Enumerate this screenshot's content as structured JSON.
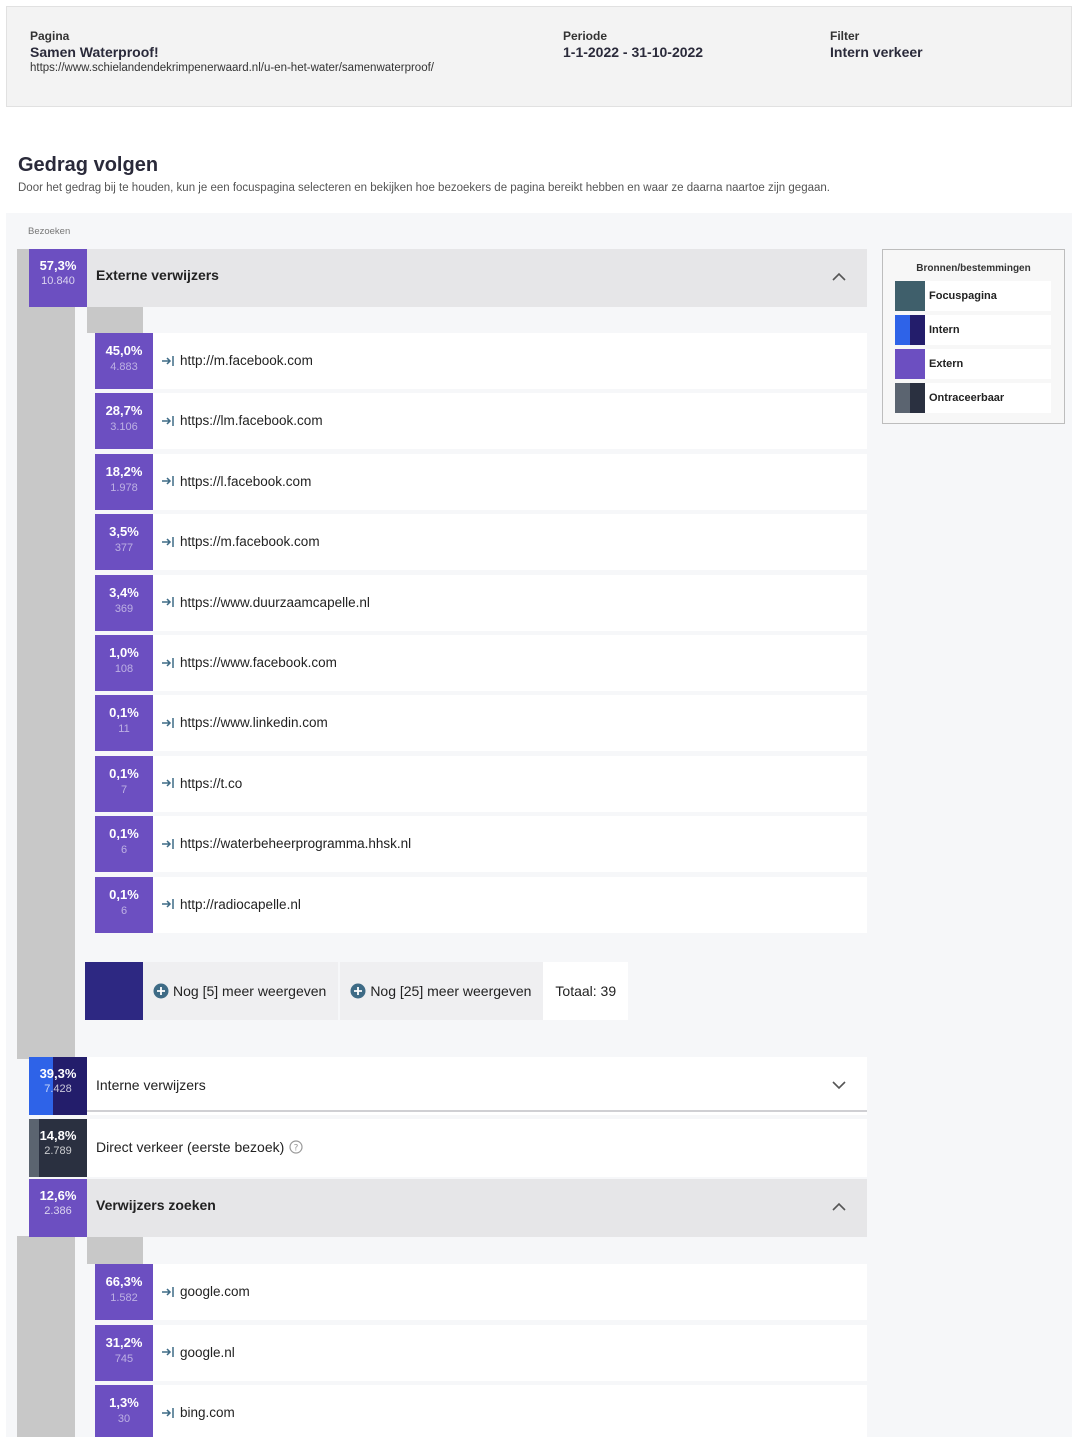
{
  "header": {
    "pagina_label": "Pagina",
    "pagina_title": "Samen Waterproof!",
    "pagina_url": "https://www.schielandendekrimpenerwaard.nl/u-en-het-water/samenwaterproof/",
    "periode_label": "Periode",
    "periode_value": "1-1-2022 - 31-10-2022",
    "filter_label": "Filter",
    "filter_value": "Intern verkeer"
  },
  "section": {
    "title": "Gedrag volgen",
    "description": "Door het gedrag bij te houden, kun je een focuspagina selecteren en bekijken hoe bezoekers de pagina bereikt hebben en waar ze daarna naartoe zijn gegaan.",
    "bezoeken_label": "Bezoeken"
  },
  "groups": [
    {
      "title": "Externe verwijzers",
      "pct": "57,3%",
      "count": "10.840",
      "state": "expanded",
      "children": [
        {
          "pct": "45,0%",
          "count": "4.883",
          "url": "http://m.facebook.com"
        },
        {
          "pct": "28,7%",
          "count": "3.106",
          "url": "https://lm.facebook.com"
        },
        {
          "pct": "18,2%",
          "count": "1.978",
          "url": "https://l.facebook.com"
        },
        {
          "pct": "3,5%",
          "count": "377",
          "url": "https://m.facebook.com"
        },
        {
          "pct": "3,4%",
          "count": "369",
          "url": "https://www.duurzaamcapelle.nl"
        },
        {
          "pct": "1,0%",
          "count": "108",
          "url": "https://www.facebook.com"
        },
        {
          "pct": "0,1%",
          "count": "11",
          "url": "https://www.linkedin.com"
        },
        {
          "pct": "0,1%",
          "count": "7",
          "url": "https://t.co"
        },
        {
          "pct": "0,1%",
          "count": "6",
          "url": "https://waterbeheerprogramma.hhsk.nl"
        },
        {
          "pct": "0,1%",
          "count": "6",
          "url": "http://radiocapelle.nl"
        }
      ],
      "more": {
        "more5": "Nog [5] meer weergeven",
        "more25": "Nog [25] meer weergeven",
        "total": "Totaal: 39"
      }
    },
    {
      "title": "Interne verwijzers",
      "pct": "39,3%",
      "count": "7.428",
      "state": "collapsed"
    },
    {
      "title": "Direct verkeer (eerste bezoek)",
      "pct": "14,8%",
      "count": "2.789",
      "state": "static"
    },
    {
      "title": "Verwijzers zoeken",
      "pct": "12,6%",
      "count": "2.386",
      "state": "expanded",
      "children": [
        {
          "pct": "66,3%",
          "count": "1.582",
          "url": "google.com"
        },
        {
          "pct": "31,2%",
          "count": "745",
          "url": "google.nl"
        },
        {
          "pct": "1,3%",
          "count": "30",
          "url": "bing.com"
        }
      ]
    }
  ],
  "legend": {
    "title": "Bronnen/bestemmingen",
    "items": [
      {
        "label": "Focuspagina",
        "colors": [
          "#3f5f6b"
        ]
      },
      {
        "label": "Intern",
        "colors": [
          "#2e63e8",
          "#231d6b"
        ]
      },
      {
        "label": "Extern",
        "colors": [
          "#6c4fc1"
        ]
      },
      {
        "label": "Ontraceerbaar",
        "colors": [
          "#5b6470",
          "#2a3040"
        ]
      }
    ]
  },
  "colors": {
    "extern": "#6c4fc1",
    "intern_light": "#2e63e8",
    "intern_dark": "#231d6b",
    "direct_light": "#5b6470",
    "direct_dark": "#2a3040",
    "more_swatch": "#2d2882",
    "plus_icon": "#3e6b86"
  }
}
